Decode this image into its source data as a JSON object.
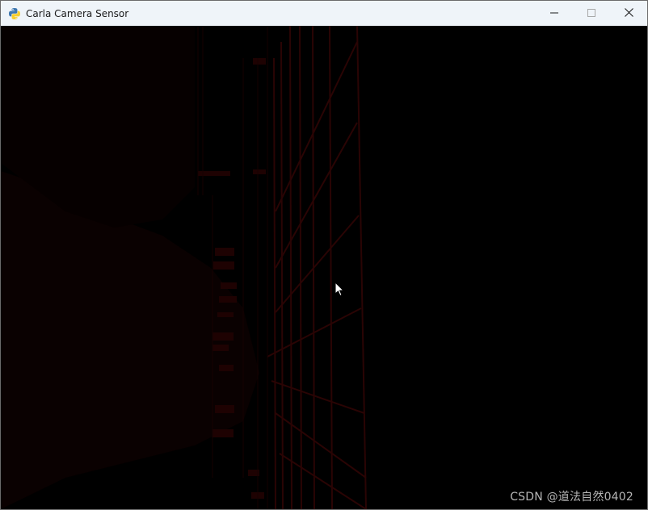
{
  "window": {
    "title": "Carla Camera Sensor",
    "app_icon": "python-icon",
    "controls": {
      "minimize_icon": "minimize-icon",
      "maximize_icon": "maximize-icon",
      "close_icon": "close-icon"
    }
  },
  "viewport": {
    "content": "camera-feed",
    "accent_color": "#3a0505",
    "watermark": "CSDN @道法自然0402"
  },
  "cursor": {
    "icon": "mouse-pointer-icon"
  }
}
